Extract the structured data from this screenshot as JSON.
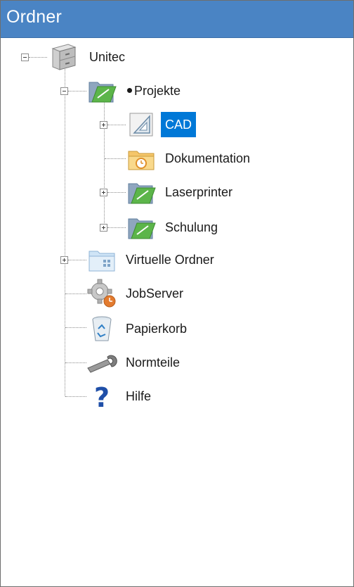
{
  "panel": {
    "title": "Ordner"
  },
  "tree": {
    "root": {
      "label": "Unitec"
    },
    "projekte": {
      "label": "Projekte"
    },
    "cad": {
      "label": "CAD"
    },
    "dokumentation": {
      "label": "Dokumentation"
    },
    "laserprinter": {
      "label": "Laserprinter"
    },
    "schulung": {
      "label": "Schulung"
    },
    "virtuelle_ordner": {
      "label": "Virtuelle Ordner"
    },
    "jobserver": {
      "label": "JobServer"
    },
    "papierkorb": {
      "label": "Papierkorb"
    },
    "normteile": {
      "label": "Normteile"
    },
    "hilfe": {
      "label": "Hilfe"
    }
  },
  "colors": {
    "header": "#4a84c4",
    "selection": "#0078d7",
    "folder_green": "#5cb54a"
  },
  "icons": {
    "root": "cabinet-icon",
    "projekte": "folder-icon",
    "cad": "triangle-icon",
    "dokumentation": "doc-folder-icon",
    "laserprinter": "folder-icon",
    "schulung": "folder-icon",
    "virtuelle_ordner": "virtual-folder-icon",
    "jobserver": "gear-icon",
    "papierkorb": "recycle-bin-icon",
    "normteile": "wrench-icon",
    "hilfe": "question-icon"
  }
}
